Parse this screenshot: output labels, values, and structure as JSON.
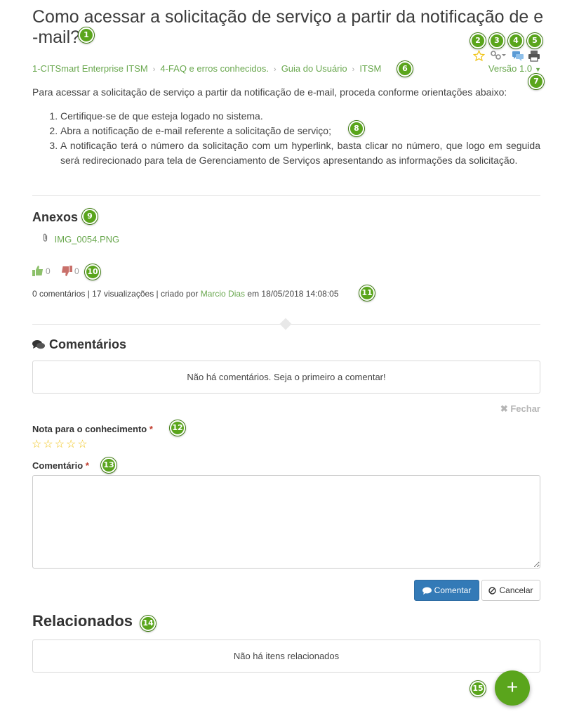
{
  "article": {
    "title": "Como acessar a solicitação de serviço a partir da notificação de e-mail?",
    "title_line1": "Como acessar a solicitação de serviço a partir da notificação de e",
    "title_line2": "-mail?",
    "intro": "Para acessar a solicitação de serviço a partir da notificação de e-mail, proceda conforme orientações abaixo:",
    "steps": [
      "Certifique-se de que esteja logado no sistema.",
      "Abra a notificação de e-mail referente a solicitação de serviço;",
      "A notificação terá o número da solicitação com um hyperlink, basta clicar no número, que logo em seguida será redirecionado para tela de Gerenciamento de Serviços apresentando as informações da solicitação."
    ]
  },
  "toolbar": {
    "icons": [
      "star-outline-icon",
      "share-link-icon",
      "comments-icon",
      "print-icon"
    ]
  },
  "breadcrumb": [
    "1-CITSmart Enterprise ITSM",
    "4-FAQ e erros conhecidos.",
    "Guia do Usuário",
    "ITSM"
  ],
  "version": {
    "label": "Versão 1.0"
  },
  "attachments": {
    "title": "Anexos",
    "files": [
      "IMG_0054.PNG"
    ]
  },
  "votes": {
    "likes": "0",
    "dislikes": "0"
  },
  "meta": {
    "prefix": "0 comentários | 17 visualizações | criado por",
    "author": "Marcio Dias",
    "suffix": "em 18/05/2018 14:08:05"
  },
  "comments": {
    "title": "Comentários",
    "empty_text": "Não há comentários. Seja o primeiro a comentar!",
    "close_label": "Fechar",
    "rating_label": "Nota para o conhecimento",
    "comment_label": "Comentário",
    "required_mark": "*",
    "submit_label": "Comentar",
    "cancel_label": "Cancelar"
  },
  "related": {
    "title": "Relacionados",
    "empty_text": "Não há itens relacionados"
  },
  "fab": {
    "label": "+"
  },
  "callouts": [
    "1",
    "2",
    "3",
    "4",
    "5",
    "6",
    "7",
    "8",
    "9",
    "10",
    "11",
    "12",
    "13",
    "14",
    "15"
  ],
  "colors": {
    "accent": "#6aa84f",
    "callout": "#5aa51c",
    "primary_button": "#337ab7",
    "star": "#f0c419"
  }
}
